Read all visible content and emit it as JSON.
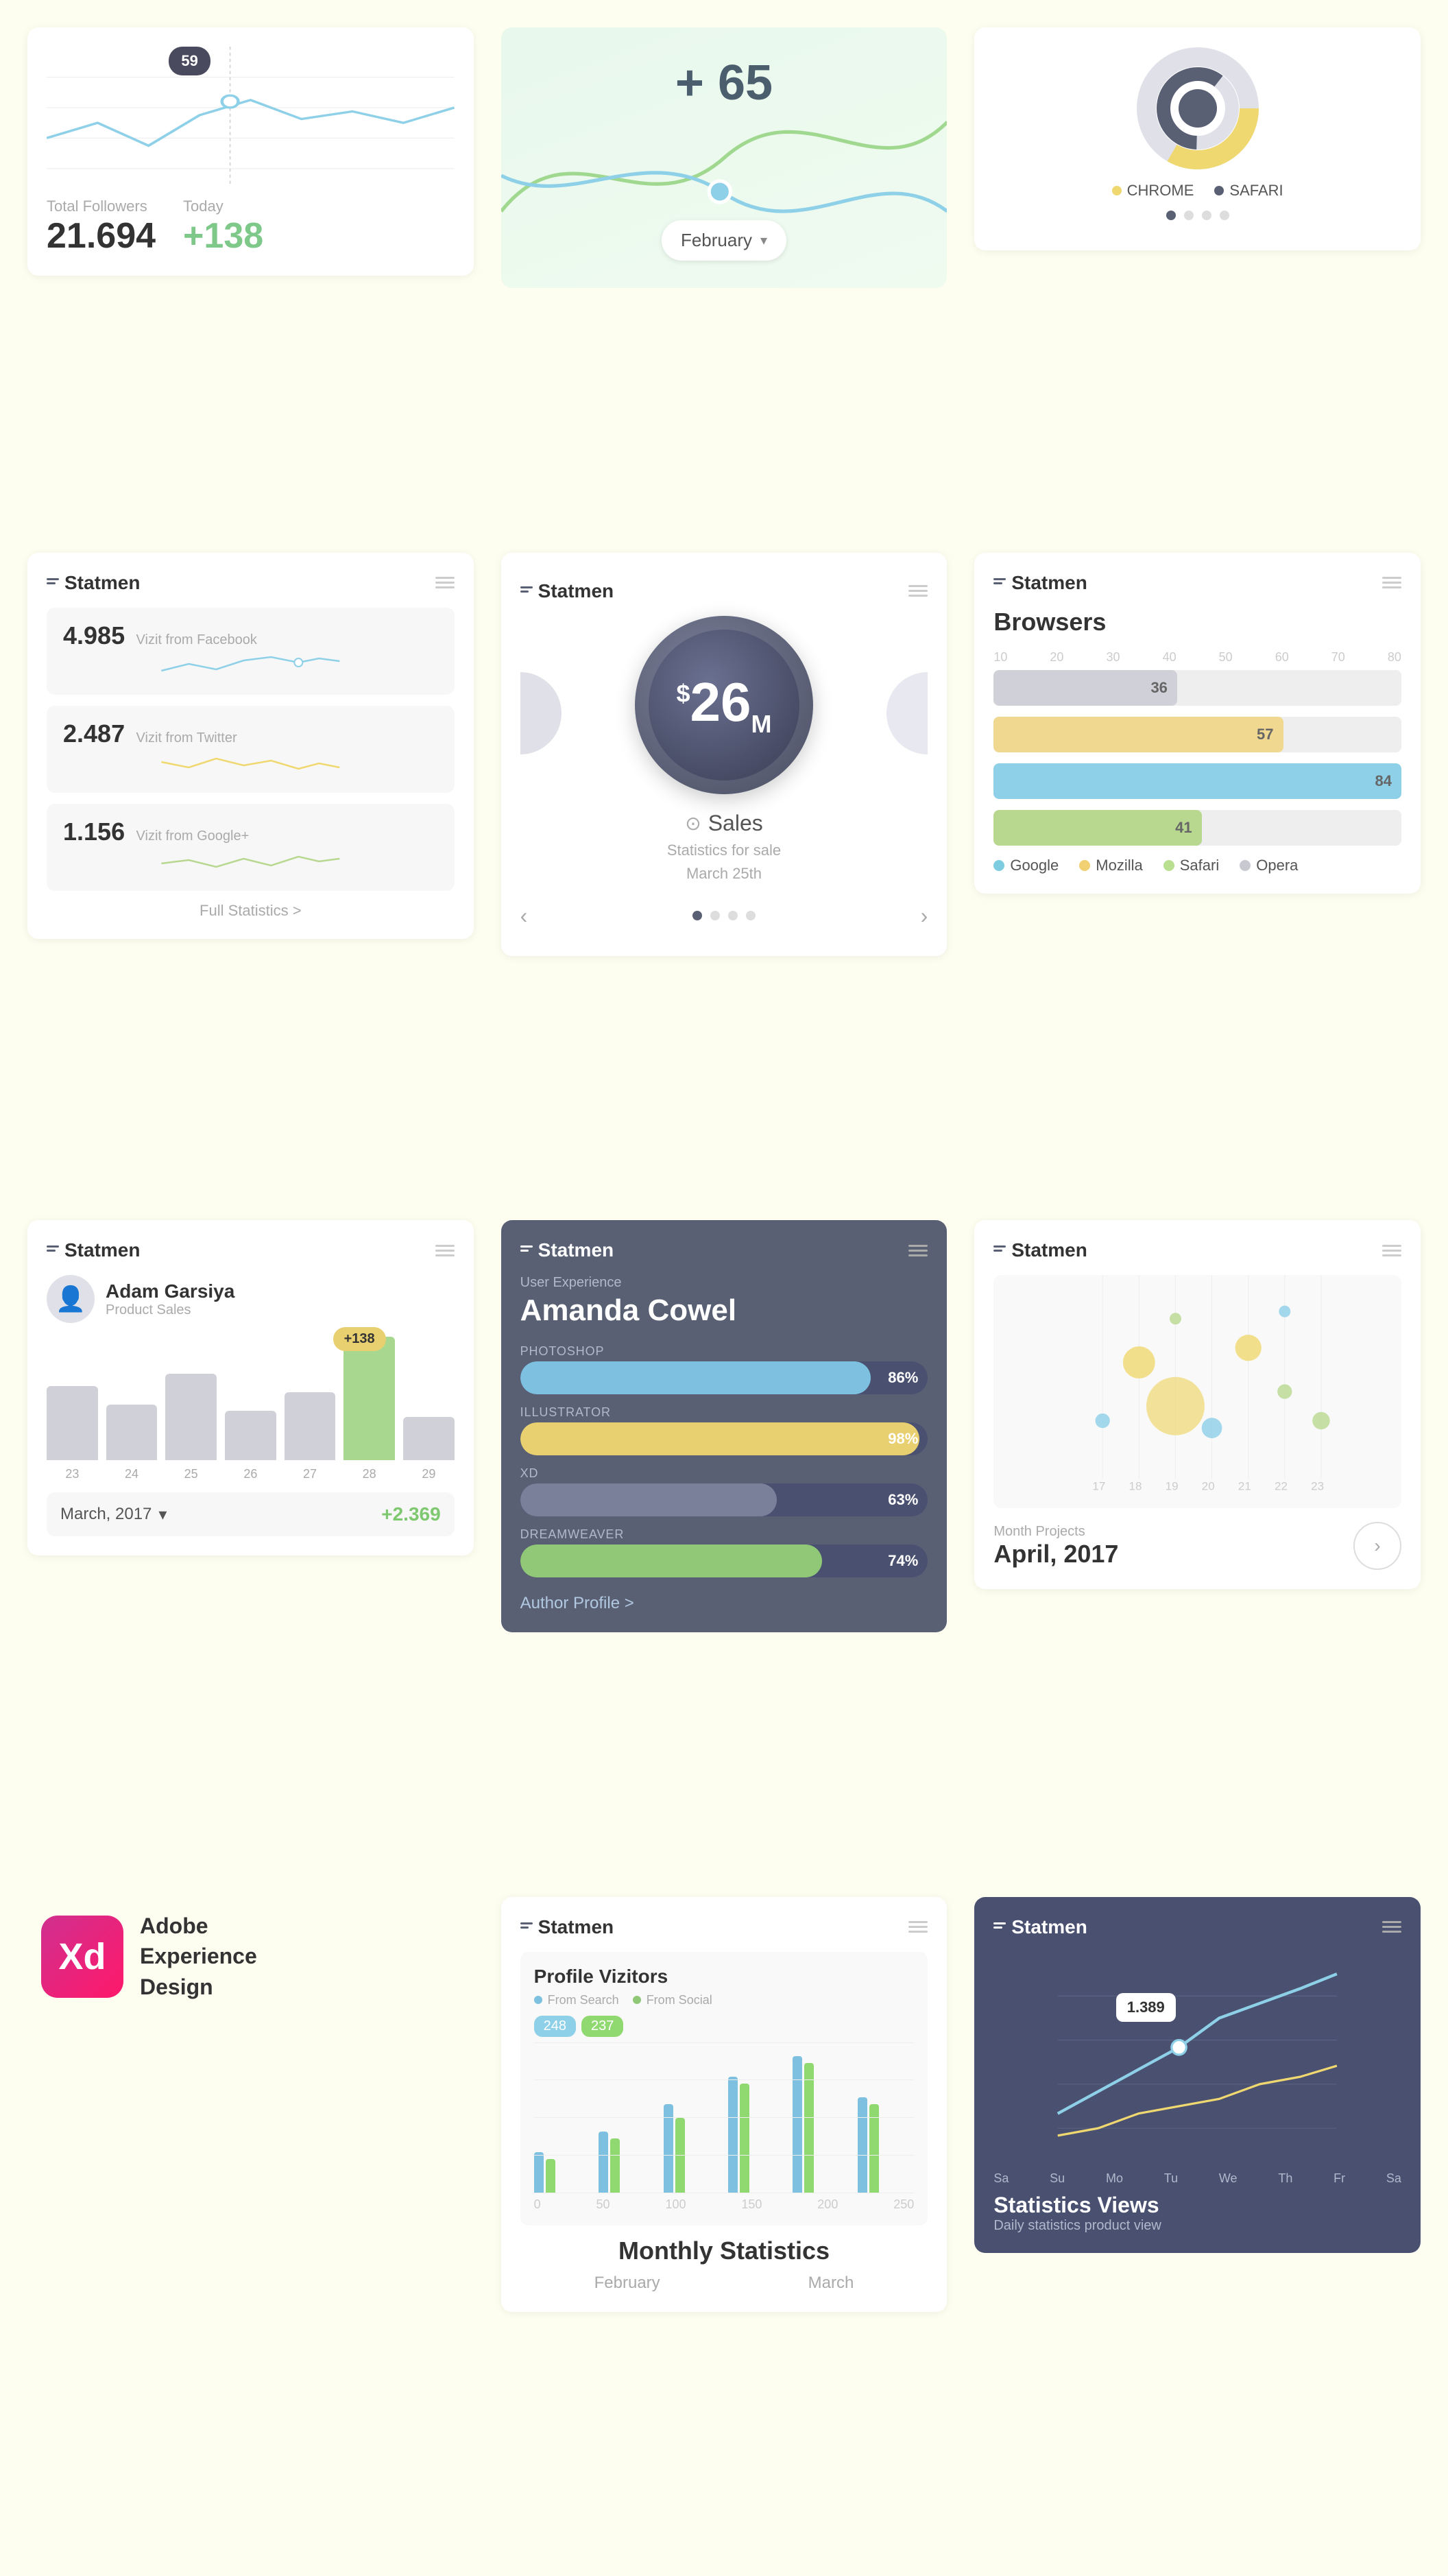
{
  "col1": {
    "followers": {
      "tooltip": "59",
      "total_label": "Total Followers",
      "total_value": "21.694",
      "today_label": "Today",
      "today_value": "+138"
    },
    "statmen1": {
      "title": "Statmen",
      "stats": [
        {
          "num": "4.985",
          "label": "Vizit from Facebook"
        },
        {
          "num": "2.487",
          "label": "Vizit from Twitter"
        },
        {
          "num": "1.156",
          "label": "Vizit from Google+"
        }
      ],
      "full_stats": "Full Statistics >"
    },
    "statmen2": {
      "title": "Statmen",
      "person_name": "Adam Garsiya",
      "person_role": "Product Sales",
      "bar_tooltip": "+138",
      "x_labels": [
        "23",
        "24",
        "25",
        "26",
        "27",
        "28",
        "29"
      ],
      "date_text": "March, 2017",
      "date_value": "+2.369"
    },
    "adobe": {
      "label1": "Adobe",
      "label2": "Experience",
      "label3": "Design"
    }
  },
  "col2": {
    "feb_badge": "+ 65",
    "feb_dropdown": "February",
    "sales_card": {
      "title": "Statmen",
      "amount": "26",
      "amount_sup": "$",
      "amount_sub": "M",
      "sales_label": "Sales",
      "subtitle": "Statistics for sale",
      "date": "March 25th"
    },
    "amanda": {
      "title": "Statmen",
      "exp_label": "User Experience",
      "name": "Amanda Cowel",
      "skills": [
        {
          "label": "PHOTOSHOP",
          "pct": "86%",
          "fill": 86
        },
        {
          "label": "ILLUSTRATOR",
          "pct": "98%",
          "fill": 98
        },
        {
          "label": "XD",
          "pct": "63%",
          "fill": 63
        },
        {
          "label": "DREAMWEAVER",
          "pct": "74%",
          "fill": 74
        }
      ],
      "author_link": "Author Profile >"
    },
    "profile_visitors": {
      "title": "Statmen",
      "chart_title": "Profile Vizitors",
      "legend_search": "From Search",
      "legend_social": "From Social",
      "tooltip1": "248",
      "tooltip2": "237",
      "monthly_title": "Monthly Statistics",
      "month1": "February",
      "month2": "March"
    }
  },
  "col3": {
    "donut_card": {
      "chrome_label": "CHROME",
      "safari_label": "SAFARI"
    },
    "browsers": {
      "title": "Statmen",
      "subtitle": "Browsers",
      "bars": [
        {
          "label": "36",
          "pct": 36,
          "color": "gray"
        },
        {
          "label": "57",
          "pct": 57,
          "color": "yellow"
        },
        {
          "label": "84",
          "pct": 84,
          "color": "blue"
        },
        {
          "label": "41",
          "pct": 41,
          "color": "green"
        }
      ],
      "legend": [
        {
          "name": "Google",
          "color": "blue"
        },
        {
          "name": "Mozilla",
          "color": "yellow"
        },
        {
          "name": "Safari",
          "color": "green"
        },
        {
          "name": "Opera",
          "color": "gray"
        }
      ]
    },
    "month_projects": {
      "title": "Statmen",
      "label": "Month Projects",
      "value": "April, 2017"
    },
    "stats_views": {
      "title": "Statmen",
      "tooltip": "1.389",
      "chart_title": "Statistics Views",
      "chart_subtitle": "Daily statistics product view",
      "x_labels": [
        "Sa",
        "Su",
        "Mo",
        "Tu",
        "We",
        "Th",
        "Fr",
        "Sa"
      ]
    }
  }
}
